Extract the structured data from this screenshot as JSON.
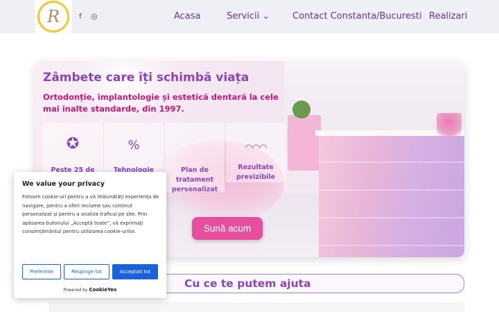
{
  "header": {
    "logo_letter": "R",
    "social": {
      "facebook": "f",
      "instagram": "◎"
    },
    "nav": [
      {
        "label": "Acasa"
      },
      {
        "label": "Servicii ⌄"
      },
      {
        "label": "Contact Constanta/Bucuresti"
      },
      {
        "label": "Realizari"
      }
    ]
  },
  "hero": {
    "title": "Zâmbete care îți schimbă viața",
    "subtitle": "Ortodonție, implantologie și estetică dentară la cele mai inalte standarde, din 1997.",
    "features": [
      {
        "icon": "award-ribbon-icon",
        "glyph": "✪",
        "label": "Peste 25 de"
      },
      {
        "icon": "percent-badge-icon",
        "glyph": "%",
        "label": "Tehnologie"
      },
      {
        "icon": "",
        "glyph": "",
        "label": "Plan de tratament personalizat"
      },
      {
        "icon": "teeth-icon",
        "glyph": "◠◠◠",
        "label": "Rezultate previzibile"
      }
    ],
    "cta_label": "Sună acum"
  },
  "section": {
    "title": "Cu ce te putem ajuta"
  },
  "cookie": {
    "title": "We value your privacy",
    "text": "Folosim cookie-uri pentru a vă îmbunătăți experiența de navigare, pentru a oferi reclame sau conținut personalizat și pentru a analiza traficul pe site. Prin apăsarea butonului „Acceptă toate”, vă exprimați consimțământul pentru utilizarea cookie-urilor.",
    "buttons": {
      "preferences": "Preferinte",
      "reject": "Respinge tot",
      "accept": "Acceptati tot"
    },
    "powered_prefix": "Powered by",
    "powered_brand": "CookieYes"
  },
  "colors": {
    "brand_purple": "#8b45b5",
    "brand_magenta": "#c0197a",
    "cta_pink": "#e64e9e",
    "cookie_blue": "#1863dc"
  }
}
